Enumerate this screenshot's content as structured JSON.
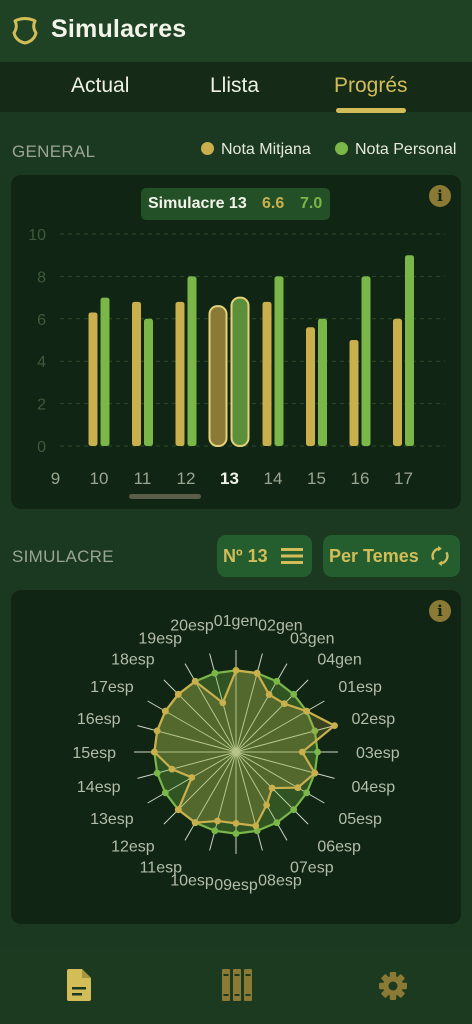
{
  "app": {
    "title": "Simulacres"
  },
  "tabs": [
    {
      "label": "Actual",
      "active": false
    },
    {
      "label": "Llista",
      "active": false
    },
    {
      "label": "Progrés",
      "active": true
    }
  ],
  "general": {
    "section_label": "GENERAL",
    "legend": [
      {
        "label": "Nota Mitjana",
        "color": "#c9b04d"
      },
      {
        "label": "Nota Personal",
        "color": "#7ab648"
      }
    ],
    "tooltip": {
      "title": "Simulacre 13",
      "mitjana": "6.6",
      "personal": "7.0"
    },
    "info_icon": "info-icon",
    "selected_label": "13"
  },
  "chart_data": {
    "type": "bar",
    "categories": [
      "9",
      "10",
      "11",
      "12",
      "13",
      "14",
      "15",
      "16",
      "17"
    ],
    "y_ticks": [
      "10",
      "8",
      "6",
      "4",
      "2",
      "0"
    ],
    "ylim": [
      0,
      10
    ],
    "series": [
      {
        "name": "Nota Mitjana",
        "color": "#c9b04d",
        "values": [
          null,
          6.3,
          6.8,
          6.8,
          6.6,
          6.8,
          5.6,
          5.0,
          6.0
        ]
      },
      {
        "name": "Nota Personal",
        "color": "#7ab648",
        "values": [
          null,
          7.0,
          6.0,
          8.0,
          7.0,
          8.0,
          6.0,
          8.0,
          9.0
        ]
      }
    ],
    "highlight_category": "13"
  },
  "simulacre": {
    "section_label": "SIMULACRE",
    "number_button": {
      "label": "Nº 13",
      "icon": "menu-icon"
    },
    "mode_button": {
      "label": "Per Temes",
      "icon": "refresh-icon"
    },
    "info_icon": "info-icon"
  },
  "radar_data": {
    "type": "radar",
    "axes": [
      "01gen",
      "02gen",
      "03gen",
      "04gen",
      "01esp",
      "02esp",
      "03esp",
      "04esp",
      "05esp",
      "06esp",
      "07esp",
      "08esp",
      "09esp",
      "10esp",
      "11esp",
      "12esp",
      "13esp",
      "14esp",
      "15esp",
      "16esp",
      "17esp",
      "18esp",
      "19esp",
      "20esp"
    ],
    "range": [
      0,
      10
    ],
    "series": [
      {
        "name": "Nota Personal",
        "color": "#7ab648",
        "values": [
          8,
          8,
          8,
          8,
          8,
          8,
          8,
          8,
          8,
          8,
          8,
          8,
          8,
          8,
          8,
          8,
          8,
          8,
          8,
          8,
          8,
          8,
          8,
          8
        ]
      },
      {
        "name": "Nota Mitjana",
        "color": "#c9b04d",
        "values": [
          8,
          8,
          6.5,
          6.7,
          8,
          10,
          6.5,
          8,
          7,
          5,
          6,
          7.5,
          7,
          7,
          8,
          8,
          5,
          6.5,
          8,
          8,
          8,
          8,
          8,
          5
        ]
      }
    ]
  },
  "bottom_nav": [
    {
      "name": "document-icon",
      "color": "#d2bd59"
    },
    {
      "name": "books-icon",
      "color": "#8b7a35"
    },
    {
      "name": "gear-icon",
      "color": "#8b7a35"
    }
  ]
}
